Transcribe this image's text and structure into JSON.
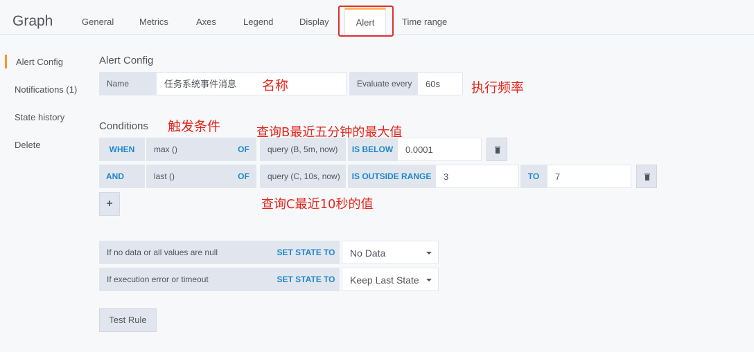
{
  "header": {
    "title": "Graph",
    "tabs": [
      "General",
      "Metrics",
      "Axes",
      "Legend",
      "Display",
      "Alert",
      "Time range"
    ],
    "active_tab": "Alert"
  },
  "sidebar": {
    "items": [
      "Alert Config",
      "Notifications (1)",
      "State history",
      "Delete"
    ]
  },
  "alert_config": {
    "heading": "Alert Config",
    "name_label": "Name",
    "name_value": "任务系统事件消息",
    "evaluate_label": "Evaluate every",
    "evaluate_value": "60s"
  },
  "conditions": {
    "heading": "Conditions",
    "rows": [
      {
        "op": "WHEN",
        "reducer": "max ()",
        "of": "OF",
        "query": "query (B, 5m, now)",
        "evaluator": "IS BELOW",
        "value": "0.0001"
      },
      {
        "op": "AND",
        "reducer": "last ()",
        "of": "OF",
        "query": "query (C, 10s, now)",
        "evaluator": "IS OUTSIDE RANGE",
        "value": "3",
        "to": "TO",
        "value2": "7"
      }
    ],
    "add_label": "+"
  },
  "no_data": {
    "label": "If no data or all values are null",
    "set_state": "SET STATE TO",
    "value": "No Data"
  },
  "exec_error": {
    "label": "If execution error or timeout",
    "set_state": "SET STATE TO",
    "value": "Keep Last State"
  },
  "test_rule_label": "Test Rule",
  "annotations": {
    "name": "名称",
    "freq": "执行频率",
    "trigger": "触发条件",
    "query_b": "查询B最近五分钟的最大值",
    "query_c": "查询C最近10秒的值"
  },
  "colors": {
    "accent": "#ffb357",
    "keyword": "#1f87c8",
    "annotation": "#e3271d",
    "highlight_box": "#e02f2f"
  }
}
